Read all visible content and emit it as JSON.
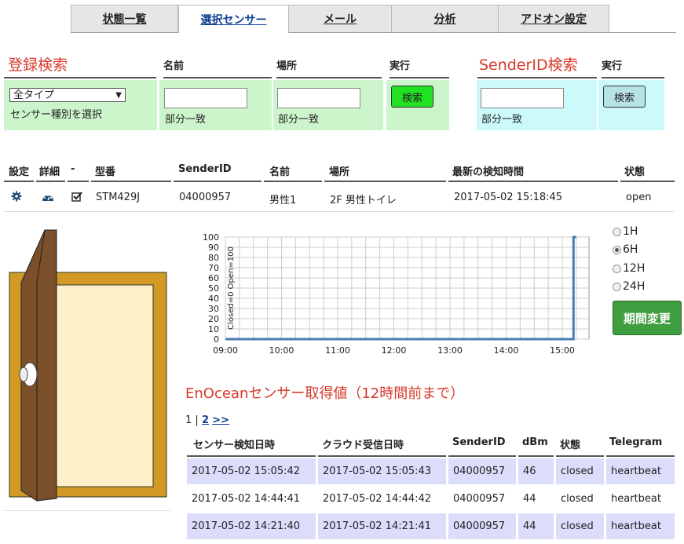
{
  "tabs": [
    {
      "label": "状態一覧",
      "active": false
    },
    {
      "label": "選択センサー",
      "active": true
    },
    {
      "label": "メール",
      "active": false
    },
    {
      "label": "分析",
      "active": false
    },
    {
      "label": "アドオン設定",
      "active": false
    }
  ],
  "search": {
    "title": "登録検索",
    "col_name": "名前",
    "col_place": "場所",
    "col_exec": "実行",
    "type_select_value": "全タイプ",
    "type_select_hint": "センサー種別を選択",
    "name_hint": "部分一致",
    "place_hint": "部分一致",
    "search_button": "検索"
  },
  "sender_search": {
    "title": "SenderID検索",
    "col_exec": "実行",
    "hint": "部分一致",
    "search_button": "検索"
  },
  "sensor_table": {
    "headers": [
      "設定",
      "詳細",
      "-",
      "型番",
      "SenderID",
      "名前",
      "場所",
      "最新の検知時間",
      "状態"
    ],
    "row": {
      "model": "STM429J",
      "sender_id": "04000957",
      "name": "男性1",
      "place": "2F 男性トイレ",
      "last_detect": "2017-05-02 15:18:45",
      "state": "open"
    }
  },
  "chart_data": {
    "type": "line",
    "ylabel": "Closed=0 Open=100",
    "ylim": [
      0,
      100
    ],
    "yticks": [
      "0",
      "10",
      "20",
      "30",
      "40",
      "50",
      "60",
      "70",
      "80",
      "90",
      "100"
    ],
    "xticks": [
      "09:00",
      "10:00",
      "11:00",
      "12:00",
      "13:00",
      "14:00",
      "15:00"
    ],
    "x": [
      "09:00",
      "15:12",
      "15:12",
      "15:15"
    ],
    "y": [
      0,
      0,
      100,
      100
    ],
    "color": "#4a7fb5",
    "grid": true
  },
  "period": {
    "options": [
      "1H",
      "6H",
      "12H",
      "24H"
    ],
    "selected": "6H",
    "button": "期間変更"
  },
  "history": {
    "title": "EnOceanセンサー取得値（12時間前まで）",
    "pager": {
      "page1": "1",
      "sep": "|",
      "page2": "2",
      "next": ">>"
    },
    "headers": [
      "センサー検知日時",
      "クラウド受信日時",
      "SenderID",
      "dBm",
      "状態",
      "Telegram"
    ],
    "rows": [
      {
        "detect": "2017-05-02 15:05:42",
        "received": "2017-05-02 15:05:43",
        "sender_id": "04000957",
        "dbm": "46",
        "state": "closed",
        "telegram": "heartbeat"
      },
      {
        "detect": "2017-05-02 14:44:41",
        "received": "2017-05-02 14:44:42",
        "sender_id": "04000957",
        "dbm": "44",
        "state": "closed",
        "telegram": "heartbeat"
      },
      {
        "detect": "2017-05-02 14:21:40",
        "received": "2017-05-02 14:21:41",
        "sender_id": "04000957",
        "dbm": "44",
        "state": "closed",
        "telegram": "heartbeat"
      }
    ]
  },
  "icons": {
    "settings": "gear-icon",
    "detail": "dashboard-icon",
    "check": "checkbox-icon",
    "door": "open-door-illustration"
  }
}
